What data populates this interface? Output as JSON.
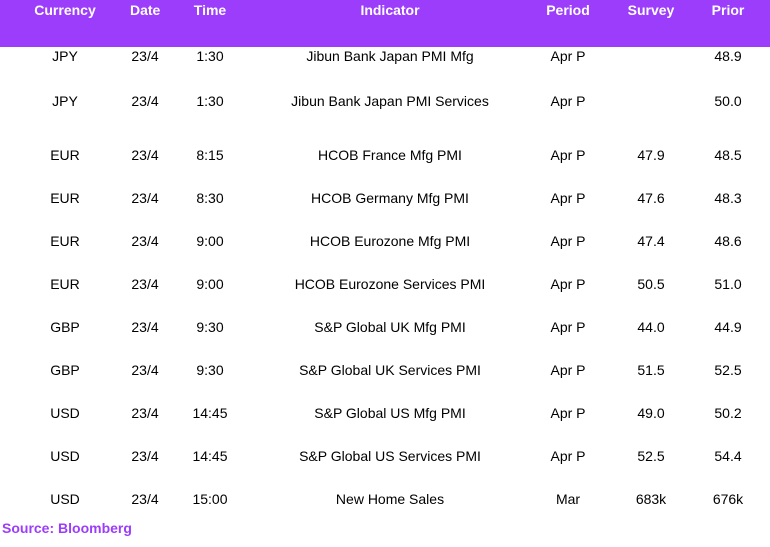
{
  "header": {
    "currency": "Currency",
    "date": "Date",
    "time": "Time",
    "indicator": "Indicator",
    "period": "Period",
    "survey": "Survey",
    "prior": "Prior"
  },
  "rows": [
    {
      "currency": "JPY",
      "date": "23/4",
      "time": "1:30",
      "indicator": "Jibun Bank Japan PMI Mfg",
      "period": "Apr P",
      "survey": "",
      "prior": "48.9"
    },
    {
      "currency": "JPY",
      "date": "23/4",
      "time": "1:30",
      "indicator": "Jibun Bank Japan PMI Services",
      "period": "Apr P",
      "survey": "",
      "prior": "50.0"
    },
    {
      "currency": "EUR",
      "date": "23/4",
      "time": "8:15",
      "indicator": "HCOB France Mfg PMI",
      "period": "Apr P",
      "survey": "47.9",
      "prior": "48.5"
    },
    {
      "currency": "EUR",
      "date": "23/4",
      "time": "8:30",
      "indicator": "HCOB Germany Mfg PMI",
      "period": "Apr P",
      "survey": "47.6",
      "prior": "48.3"
    },
    {
      "currency": "EUR",
      "date": "23/4",
      "time": "9:00",
      "indicator": "HCOB Eurozone Mfg PMI",
      "period": "Apr P",
      "survey": "47.4",
      "prior": "48.6"
    },
    {
      "currency": "EUR",
      "date": "23/4",
      "time": "9:00",
      "indicator": "HCOB Eurozone Services PMI",
      "period": "Apr P",
      "survey": "50.5",
      "prior": "51.0"
    },
    {
      "currency": "GBP",
      "date": "23/4",
      "time": "9:30",
      "indicator": "S&P Global UK Mfg PMI",
      "period": "Apr P",
      "survey": "44.0",
      "prior": "44.9"
    },
    {
      "currency": "GBP",
      "date": "23/4",
      "time": "9:30",
      "indicator": "S&P Global UK Services PMI",
      "period": "Apr P",
      "survey": "51.5",
      "prior": "52.5"
    },
    {
      "currency": "USD",
      "date": "23/4",
      "time": "14:45",
      "indicator": "S&P Global US Mfg PMI",
      "period": "Apr P",
      "survey": "49.0",
      "prior": "50.2"
    },
    {
      "currency": "USD",
      "date": "23/4",
      "time": "14:45",
      "indicator": "S&P Global US Services PMI",
      "period": "Apr P",
      "survey": "52.5",
      "prior": "54.4"
    },
    {
      "currency": "USD",
      "date": "23/4",
      "time": "15:00",
      "indicator": "New Home Sales",
      "period": "Mar",
      "survey": "683k",
      "prior": "676k"
    }
  ],
  "source": "Source: Bloomberg",
  "colors": {
    "header_bg": "#9b3dfb",
    "header_text": "#ffffff",
    "source_text": "#9b3dfb"
  }
}
